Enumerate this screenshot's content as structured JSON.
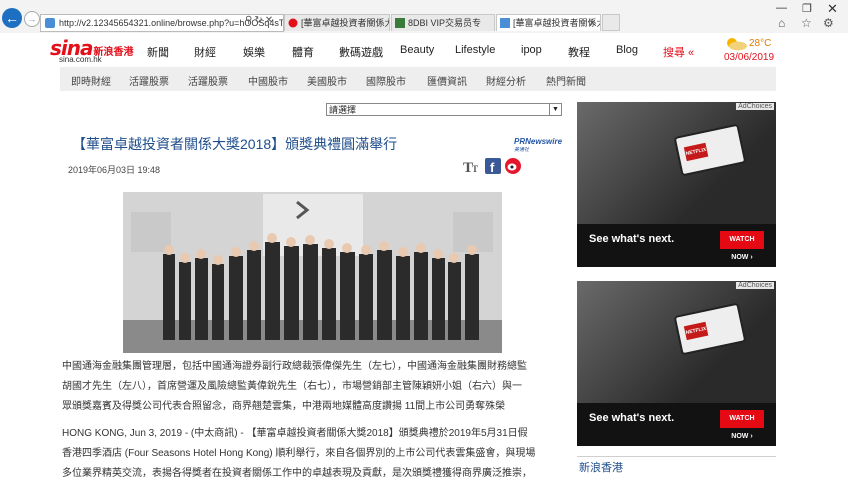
{
  "browser": {
    "url": "http://v2.12345654321.online/browse.php?u=hOOSq4sT",
    "tabs": [
      {
        "label": "[華富卓越投資者關係大獎20...",
        "active": false
      },
      {
        "label": "8DBI VIP交易员专",
        "active": false
      },
      {
        "label": "[華富卓越投資者關係大獎...",
        "active": true
      }
    ]
  },
  "site": {
    "logo_text": "sina",
    "logo_sub": "新浪香港",
    "logo_domain": "sina.com.hk",
    "nav": [
      "新聞",
      "財經",
      "娛樂",
      "體育",
      "數碼遊戲",
      "Beauty",
      "Lifestyle",
      "ipop",
      "教程",
      "Blog"
    ],
    "nav_more": "搜尋 «",
    "temperature": "28°C",
    "date": "03/06/2019"
  },
  "subnav": [
    "即時財經",
    "活躍股票",
    "活躍股票",
    "中國股市",
    "美國股市",
    "國際股市",
    "匯價資訊",
    "財經分析",
    "熱門新聞"
  ],
  "select_label": "請選擇",
  "article": {
    "title": "【華富卓越投資者關係大獎2018】頒獎典禮圓滿舉行",
    "prn_label": "PRNewswire",
    "prn_sub": "美通社",
    "pubdate": "2019年06月03日  19:48",
    "para1_line1": "中國通海金融集團管理層，包括中國通海證券副行政總裁張偉傑先生（左七），中國通海金融集團財務總監",
    "para1_line2": "胡國才先生（左八），首席營運及風險總監黃偉銳先生（右七），市場營銷部主管陳穎妍小姐（右六）與一",
    "para1_line3": "眾頒獎嘉賓及得獎公司代表合照留念，商界翹楚雲集，中港兩地媒體高度讚揚 11間上市公司勇奪殊榮",
    "para2_line1": "HONG KONG, Jun 3, 2019 - (中太商訊) - 【華富卓越投資者關係大獎2018】頒獎典禮於2019年5月31日假",
    "para2_line2": "香港四季酒店 (Four Seasons Hotel Hong Kong) 順利舉行，來自各個界別的上市公司代表雲集盛會，與現場",
    "para2_line3": "多位業界精英交流，表揚各得獎者在投資者關係工作中的卓越表現及貢獻，是次頒獎禮獲得商界廣泛推崇，"
  },
  "ads": [
    {
      "choice": "AdChoices",
      "cta": "See what's next.",
      "button": "WATCH NOW ›",
      "brand": "NETFLIX"
    },
    {
      "choice": "AdChoices",
      "cta": "See what's next.",
      "button": "WATCH NOW ›",
      "brand": "NETFLIX"
    }
  ],
  "sidebar_link": "新浪香港"
}
